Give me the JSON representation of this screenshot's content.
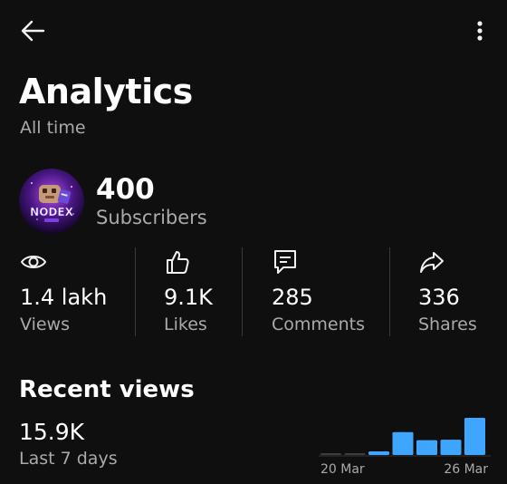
{
  "header": {
    "title": "Analytics",
    "subtitle": "All time",
    "back_icon": "back-arrow-icon",
    "more_icon": "more-vertical-icon"
  },
  "channel": {
    "avatar_text": "NODEX",
    "subscribers": "400",
    "subscribers_label": "Subscribers"
  },
  "stats": [
    {
      "icon": "eye-icon",
      "value": "1.4 lakh",
      "label": "Views"
    },
    {
      "icon": "thumbs-up-icon",
      "value": "9.1K",
      "label": "Likes"
    },
    {
      "icon": "comment-icon",
      "value": "285",
      "label": "Comments"
    },
    {
      "icon": "share-icon",
      "value": "336",
      "label": "Shares"
    }
  ],
  "recent": {
    "title": "Recent views",
    "value": "15.9K",
    "period": "Last 7 days"
  },
  "colors": {
    "background": "#0f0f0f",
    "text": "#f1f1f1",
    "secondary_text": "#aaaaaa",
    "bar": "#3ea6ff",
    "bar_empty": "#3d3d3d",
    "divider": "#3a3a3a"
  },
  "chart_data": {
    "type": "bar",
    "categories": [
      "",
      "",
      "",
      "",
      "",
      "",
      ""
    ],
    "values": [
      0.05,
      0.05,
      0.14,
      0.88,
      0.57,
      0.59,
      1.43
    ],
    "tick_labels": [
      "20 Mar",
      "26 Mar"
    ],
    "title": "",
    "xlabel": "",
    "ylabel": "",
    "grid": false
  }
}
